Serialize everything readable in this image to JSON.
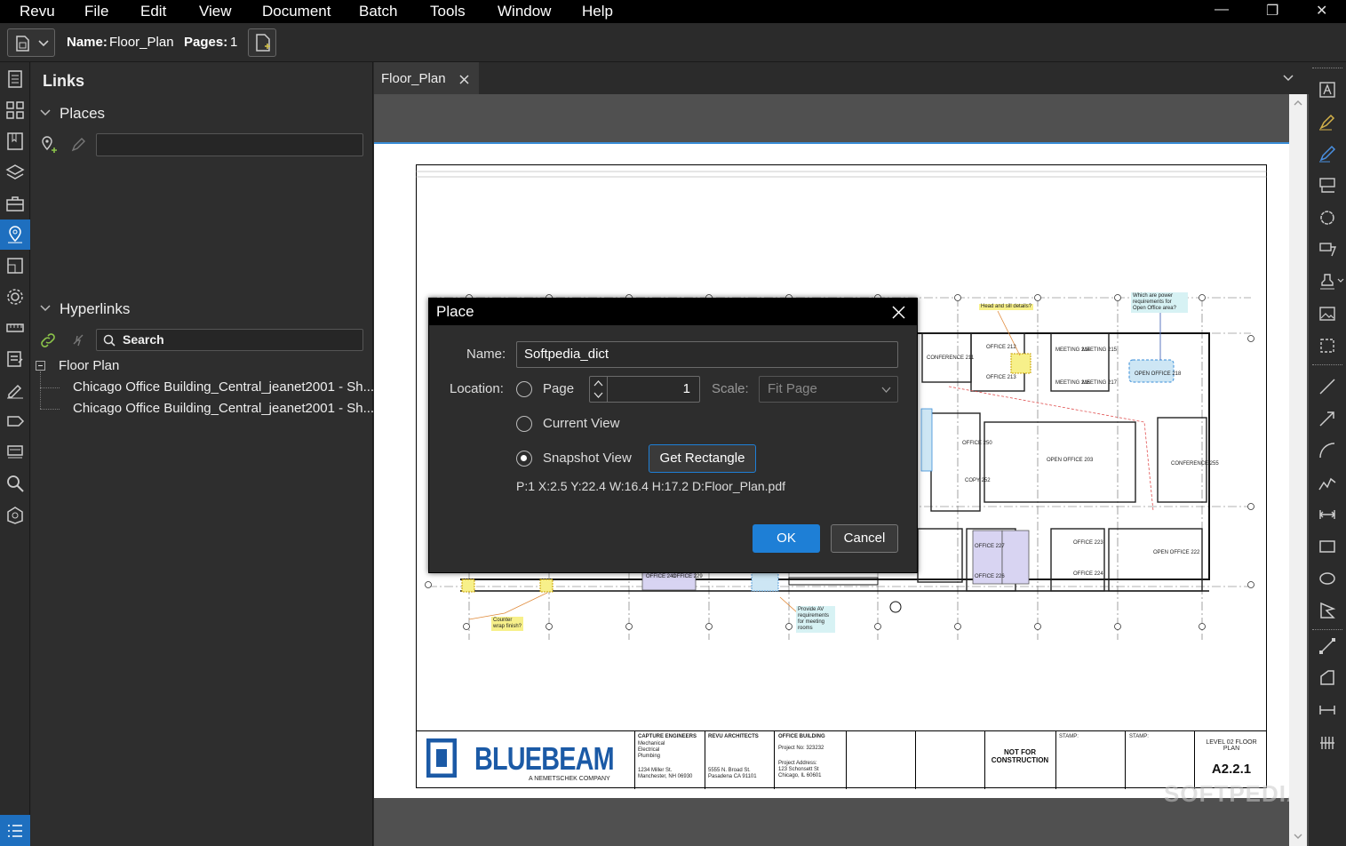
{
  "menubar": {
    "items": [
      "Revu",
      "File",
      "Edit",
      "View",
      "Document",
      "Batch",
      "Tools",
      "Window",
      "Help"
    ],
    "minimize": "—",
    "restore": "❐",
    "close": "✕"
  },
  "toolbar": {
    "name_label": "Name:",
    "name_value": "Floor_Plan",
    "pages_label": "Pages:",
    "pages_value": "1"
  },
  "panel": {
    "title": "Links",
    "places_header": "Places",
    "places_input": "",
    "hyperlinks_header": "Hyperlinks",
    "search_placeholder": "Search",
    "tree_root": "Floor Plan",
    "tree_items": [
      "Chicago Office Building_Central_jeanet2001 - Sh...",
      "Chicago Office Building_Central_jeanet2001 - Sh..."
    ]
  },
  "document": {
    "tab_label": "Floor_Plan",
    "titleblock": {
      "logo": "BLUEBEAM",
      "logo_sub": "A NEMETSCHEK COMPANY",
      "engineers_title": "CAPTURE ENGINEERS",
      "engineers_lines": [
        "Mechanical",
        "Electrical",
        "Plumbing",
        "",
        "1234 Miller St.",
        "Manchester, NH 06930"
      ],
      "architects_title": "REVU ARCHITECTS",
      "architects_lines": [
        "5555 N. Broad St.",
        "Pasadena CA 91101"
      ],
      "building_title": "OFFICE BUILDING",
      "building_lines": [
        "Project No: 323232",
        "",
        "Project Address:",
        "123 Schonsett St",
        "Chicago, IL 60601"
      ],
      "not_for_construction": "NOT FOR CONSTRUCTION",
      "stamp1": "STAMP:",
      "stamp2": "STAMP:",
      "sheet_title": "LEVEL 02 FLOOR PLAN",
      "sheet_number": "A2.2.1"
    },
    "plan_rooms": [
      "CONFERENCE 211",
      "OFFICE 212",
      "OFFICE 213",
      "MEETING 214",
      "MEETING 215",
      "MEETING 216",
      "MEETING 217",
      "OPEN OFFICE 218",
      "OFFICE 250",
      "COPY 252",
      "OPEN OFFICE 203",
      "CONFERENCE 255",
      "OFFICE 227",
      "OFFICE 226",
      "OFFICE 223",
      "OFFICE 224",
      "OPEN OFFICE 222",
      "OFFICE 241",
      "OFFICE 229"
    ],
    "callouts": [
      "Head and sill details?",
      "Which are power requirements for Open Office area?",
      "Counter wrap finish?",
      "Provide AV requirements for meeting rooms"
    ]
  },
  "dialog": {
    "title": "Place",
    "name_label": "Name:",
    "name_value": "Softpedia_dict",
    "location_label": "Location:",
    "opt_page": "Page",
    "page_value": "1",
    "scale_label": "Scale:",
    "scale_value": "Fit Page",
    "opt_current": "Current View",
    "opt_snapshot": "Snapshot View",
    "get_rect": "Get Rectangle",
    "snapshot_info": "P:1 X:2.5 Y:22.4 W:16.4 H:17.2 D:Floor_Plan.pdf",
    "ok": "OK",
    "cancel": "Cancel"
  },
  "watermark": "SOFTPEDIA",
  "colors": {
    "accent": "#1e7fd6",
    "bluebeam": "#1b5aa6",
    "active_rail": "#1e6fbf"
  }
}
